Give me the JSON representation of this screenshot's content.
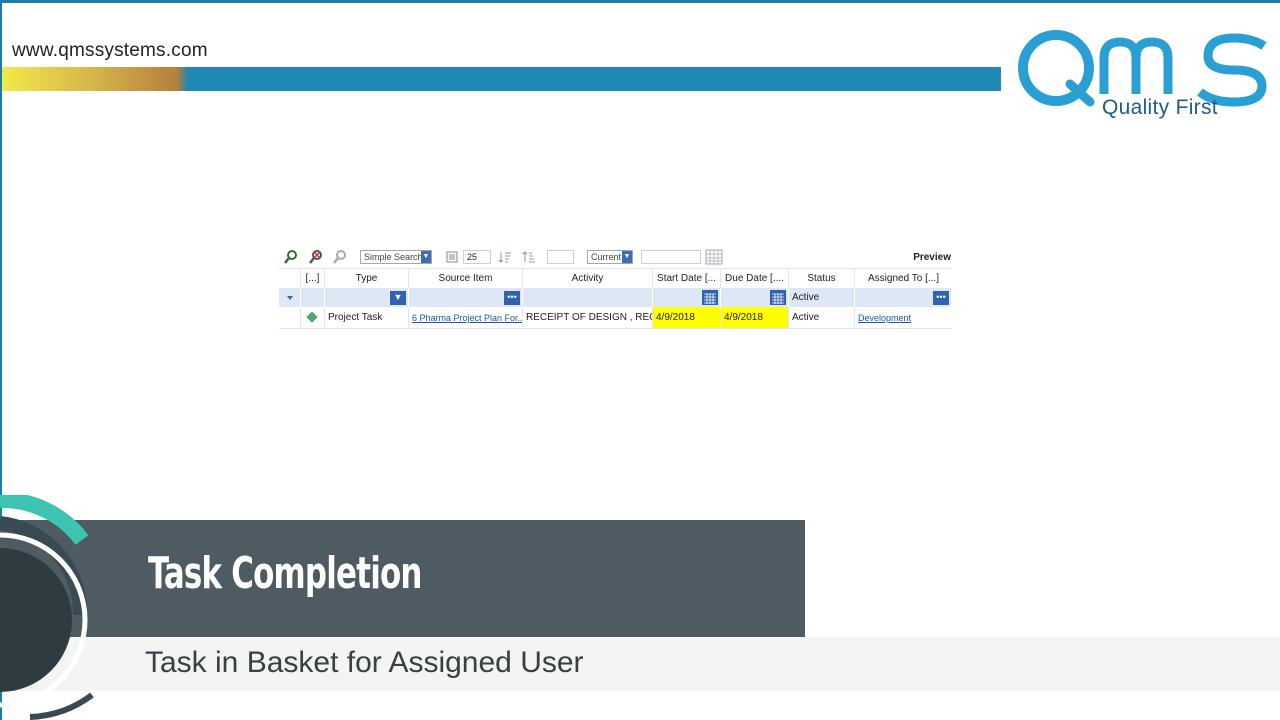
{
  "header": {
    "site_url": "www.qmssystems.com",
    "logo_text": "QMS",
    "logo_tagline": "Quality First",
    "colors": {
      "brand_blue": "#1e89b2",
      "accent_yellow": "#f2e94a"
    }
  },
  "grid": {
    "toolbar": {
      "search_mode": "Simple Search",
      "page_size": "25",
      "version_filter": "Current",
      "preview_label": "Preview"
    },
    "columns": [
      "[...]",
      "Type",
      "Source Item",
      "Activity",
      "Start Date [...",
      "Due Date [....",
      "Status",
      "Assigned To [...]"
    ],
    "filter_row": {
      "status": "Active"
    },
    "rows": [
      {
        "type": "Project Task",
        "source_item": "6 Pharma Project Plan For...",
        "activity": "RECEIPT OF DESIGN , REC...",
        "start_date": "4/9/2018",
        "due_date": "4/9/2018",
        "status": "Active",
        "assigned_to": "Development"
      }
    ]
  },
  "slide": {
    "title": "Task Completion",
    "subtitle": "Task in Basket for Assigned User"
  }
}
